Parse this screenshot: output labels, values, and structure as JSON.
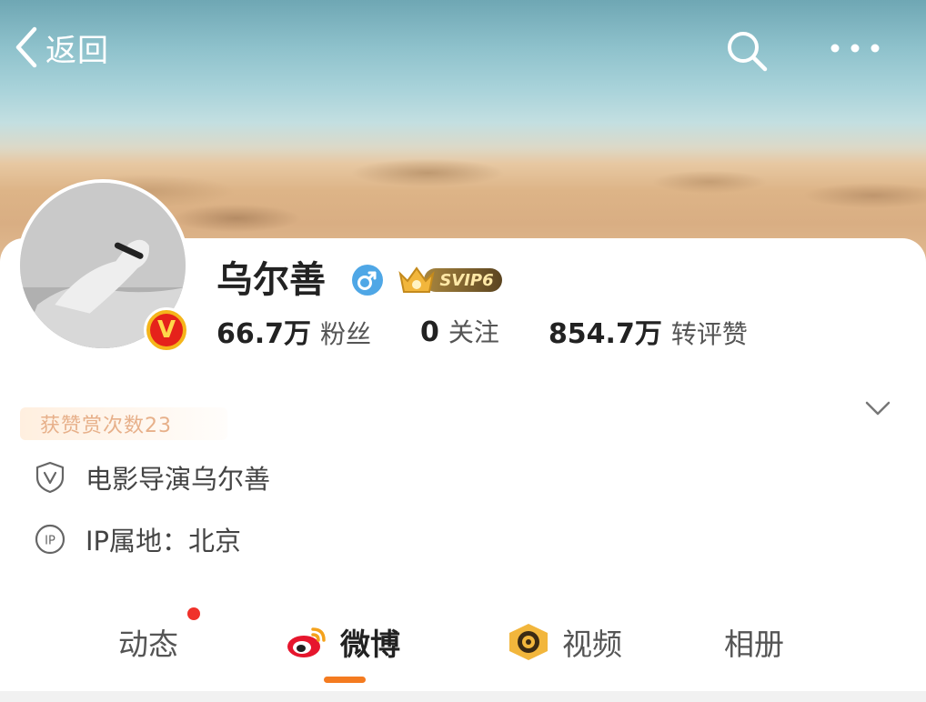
{
  "nav": {
    "back_label": "返回",
    "search_icon": "search-icon",
    "more_icon": "more-icon"
  },
  "profile": {
    "name": "乌尔善",
    "gender_icon": "male-icon",
    "vip_badge": "SVIP6",
    "verified_icon": "verified-v-icon",
    "stats": [
      {
        "value": "66.7万",
        "label": "粉丝"
      },
      {
        "value": "0",
        "label": "关注"
      },
      {
        "value": "854.7万",
        "label": "转评赞"
      }
    ],
    "reward_text": "获赞赏次数23",
    "certification": "电影导演乌尔善",
    "ip_location": "IP属地：北京"
  },
  "tabs": [
    {
      "label": "动态",
      "has_dot": true
    },
    {
      "label": "微博",
      "active": true,
      "icon": "weibo-logo-icon"
    },
    {
      "label": "视频",
      "icon": "video-icon"
    },
    {
      "label": "相册"
    }
  ],
  "colors": {
    "accent": "#f47b20",
    "notification_dot": "#f0312a",
    "verified_badge": "#f5b51b",
    "gender": "#4fa7e6"
  }
}
